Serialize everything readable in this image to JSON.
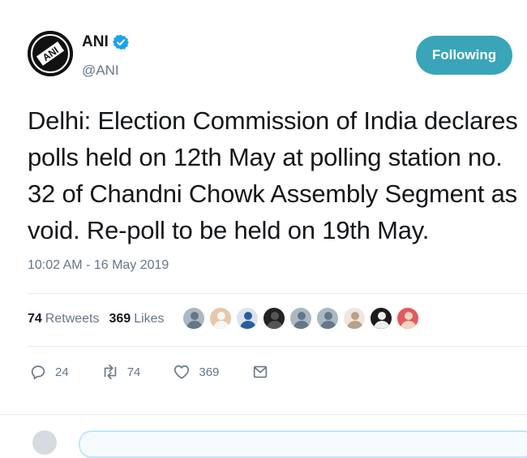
{
  "author": {
    "display_name": "ANI",
    "handle": "@ANI",
    "verified": true,
    "avatar_icon": "ani-logo-icon"
  },
  "follow_button": {
    "label": "Following",
    "color": "#3aa5b8"
  },
  "tweet": {
    "lines": [
      "Delhi: Election Commission of India declares",
      "polls held on 12th May at polling station no.",
      "32 of Chandni Chowk Assembly Segment as",
      "void. Re-poll to be held on 19th May."
    ],
    "timestamp": "10:02 AM - 16 May 2019"
  },
  "stats": {
    "retweets_count": "74",
    "retweets_label": "Retweets",
    "likes_count": "369",
    "likes_label": "Likes"
  },
  "likers": [
    {
      "icon": "default-avatar-icon",
      "bg": "#aab8c2",
      "fg": "#657786"
    },
    {
      "icon": "user-avatar-icon",
      "bg": "#e8c8a8",
      "fg": "#f7f7f7"
    },
    {
      "icon": "user-avatar-icon",
      "bg": "#d9e4ee",
      "fg": "#2a5d9f"
    },
    {
      "icon": "user-avatar-icon",
      "bg": "#222222",
      "fg": "#555555"
    },
    {
      "icon": "default-avatar-icon",
      "bg": "#aab8c2",
      "fg": "#657786"
    },
    {
      "icon": "default-avatar-icon",
      "bg": "#aab8c2",
      "fg": "#657786"
    },
    {
      "icon": "user-avatar-icon",
      "bg": "#f2e6dc",
      "fg": "#b8a08a"
    },
    {
      "icon": "user-avatar-icon",
      "bg": "#1b1b1b",
      "fg": "#eeeeee"
    },
    {
      "icon": "user-avatar-icon",
      "bg": "#e25a5a",
      "fg": "#f4d3c0"
    }
  ],
  "actions": {
    "reply_count": "24",
    "retweet_count": "74",
    "like_count": "369",
    "reply_icon": "reply-icon",
    "retweet_icon": "retweet-icon",
    "like_icon": "heart-icon",
    "message_icon": "envelope-icon"
  }
}
